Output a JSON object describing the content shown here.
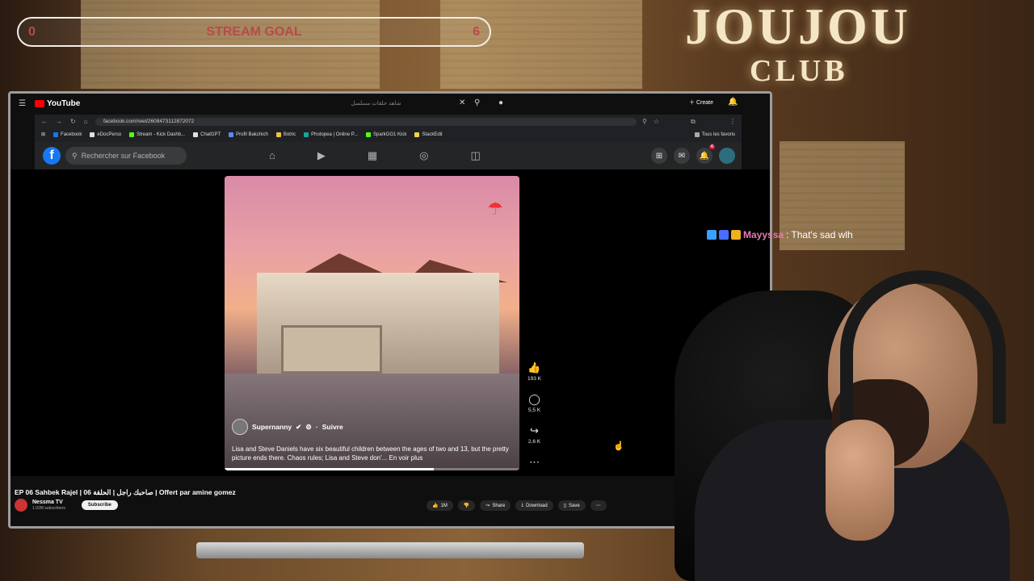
{
  "overlay": {
    "brand_line1": "JOUJOU",
    "brand_line2": "CLUB",
    "goal": {
      "title": "STREAM GOAL",
      "current": "0",
      "target": "6"
    }
  },
  "chat": {
    "username": "Mayyssa",
    "separator": ":",
    "message": "That's sad wlh"
  },
  "youtube": {
    "logo": "YouTube",
    "search_value": "شاهد حلقات مسلسل",
    "create_label": "Create",
    "video_title": "EP 06 Sahbek Rajel | صاحبك راجل | الحلقة 06 | Offert par amine gomez",
    "channel_name": "Nessma TV",
    "channel_subs": "1.02M subscribers",
    "subscribe_label": "Subscribe",
    "likes": "1M",
    "share_label": "Share",
    "download_label": "Download",
    "save_label": "Save"
  },
  "browser": {
    "url": "facebook.com/reel/2608473112872072",
    "bookmarks": [
      {
        "label": "Facebook",
        "color": "#1877f2"
      },
      {
        "label": "eDocPerso",
        "color": "#e0e0e0"
      },
      {
        "label": "Stream - Kick Dashb...",
        "color": "#53fc18"
      },
      {
        "label": "ChatGPT",
        "color": "#e0e0e0"
      },
      {
        "label": "Profil Bakchich",
        "color": "#5b8def"
      },
      {
        "label": "Botric",
        "color": "#f0c040"
      },
      {
        "label": "Photopea | Online P...",
        "color": "#18a497"
      },
      {
        "label": "SparkGG1 Kick",
        "color": "#53fc18"
      },
      {
        "label": "StackEdit",
        "color": "#f0d050"
      }
    ],
    "all_bookmarks": "Tous les favoris"
  },
  "facebook": {
    "search_placeholder": "Rechercher sur Facebook",
    "notifications_badge": "4",
    "reel": {
      "author": "Supernanny",
      "follow_label": "Suivre",
      "caption": "Lisa and Steve Daniels have six beautiful children between the ages of two and 13, but the pretty picture ends there. Chaos rules; Lisa and Steve don'... En voir plus",
      "likes": "193 K",
      "comments": "5,5 K",
      "shares": "2,6 K",
      "progress": 0.71
    }
  },
  "colors": {
    "accent": "#1877f2",
    "goal_text": "#b84a4a",
    "chat_user": "#e77ab0",
    "yt_red": "#ff0000"
  }
}
